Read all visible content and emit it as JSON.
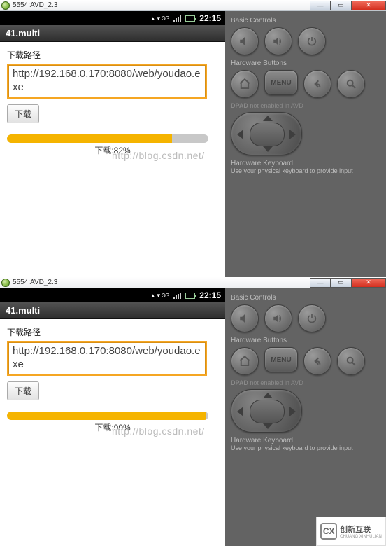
{
  "instances": [
    {
      "window_title": "5554:AVD_2.3",
      "status_time": "22:15",
      "status_net": "3G",
      "app_title": "41.multi",
      "path_label": "下载路径",
      "url_value": "http://192.168.0.170:8080/web/youdao.exe",
      "download_btn": "下载",
      "progress_pct": 82,
      "progress_text": "下载:82%",
      "watermark": "http://blog.csdn.net/"
    },
    {
      "window_title": "5554:AVD_2.3",
      "status_time": "22:15",
      "status_net": "3G",
      "app_title": "41.multi",
      "path_label": "下载路径",
      "url_value": "http://192.168.0.170:8080/web/youdao.exe",
      "download_btn": "下载",
      "progress_pct": 99,
      "progress_text": "下载:99%",
      "watermark": "http://blog.csdn.net/"
    }
  ],
  "sidepanel": {
    "basic_controls": "Basic Controls",
    "hardware_buttons": "Hardware Buttons",
    "menu_label": "MENU",
    "dpad_label": "DPAD",
    "dpad_note": "not enabled in AVD",
    "hw_kbd": "Hardware Keyboard",
    "hw_kbd_sub": "Use your physical keyboard to provide input"
  },
  "logo": {
    "mark": "CX",
    "name": "创新互联",
    "sub": "CHUANG XINHULIAN"
  }
}
